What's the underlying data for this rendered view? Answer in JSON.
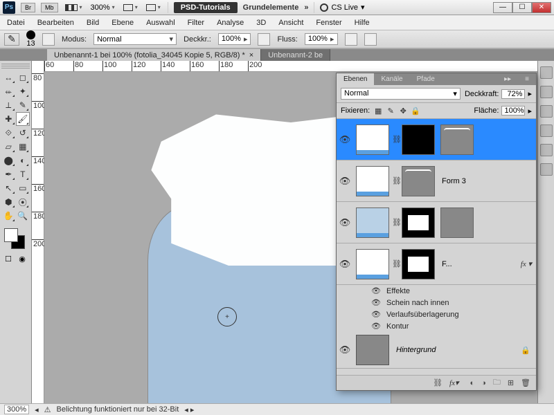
{
  "titlebar": {
    "zoom": "300%",
    "tab1": "PSD-Tutorials",
    "tab2": "Grundelemente",
    "cslive": "CS Live"
  },
  "menu": [
    "Datei",
    "Bearbeiten",
    "Bild",
    "Ebene",
    "Auswahl",
    "Filter",
    "Analyse",
    "3D",
    "Ansicht",
    "Fenster",
    "Hilfe"
  ],
  "options": {
    "brush_size": "13",
    "mode_label": "Modus:",
    "mode_value": "Normal",
    "opacity_label": "Deckkr.:",
    "opacity_value": "100%",
    "flow_label": "Fluss:",
    "flow_value": "100%"
  },
  "tabs": {
    "t1": "Unbenannt-1 bei 100% (fotolia_34045 Kopie 5, RGB/8) *",
    "t2": "Unbenannt-2 be"
  },
  "ruler_h": [
    "60",
    "80",
    "100",
    "120",
    "140",
    "160",
    "180",
    "200"
  ],
  "ruler_v": [
    "80",
    "100",
    "120",
    "140",
    "160",
    "180",
    "200"
  ],
  "layers_panel": {
    "tabs": {
      "layers": "Ebenen",
      "channels": "Kanäle",
      "paths": "Pfade"
    },
    "blend_mode": "Normal",
    "opacity_label": "Deckkraft:",
    "opacity_value": "72%",
    "lock_label": "Fixieren:",
    "fill_label": "Fläche:",
    "fill_value": "100%",
    "layer_form3": "Form 3",
    "layer_f": "F...",
    "fx_title": "Effekte",
    "fx_inner_glow": "Schein nach innen",
    "fx_gradient": "Verlaufsüberlagerung",
    "fx_stroke": "Kontur",
    "background": "Hintergrund"
  },
  "status": {
    "zoom": "300%",
    "msg": "Belichtung funktioniert nur bei 32-Bit"
  }
}
